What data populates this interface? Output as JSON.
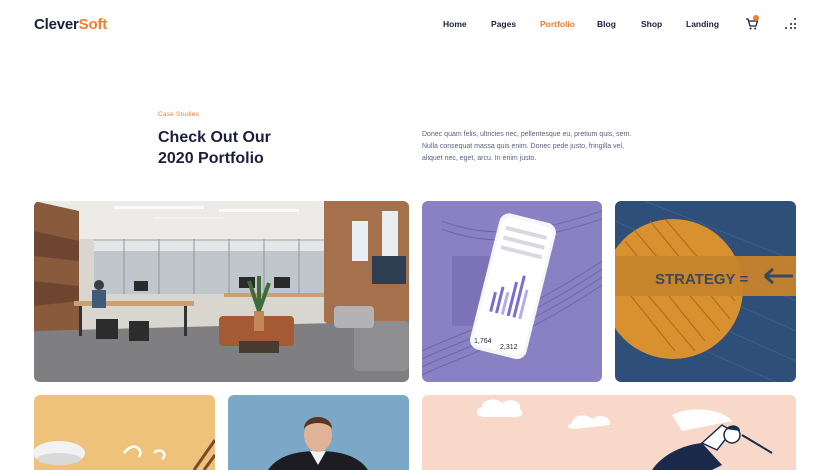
{
  "brand": {
    "part1": "Clever",
    "part2": "Soft"
  },
  "nav": {
    "items": [
      {
        "label": "Home",
        "active": false
      },
      {
        "label": "Pages",
        "active": false
      },
      {
        "label": "Portfolio",
        "active": true
      },
      {
        "label": "Blog",
        "active": false
      },
      {
        "label": "Shop",
        "active": false
      },
      {
        "label": "Landing",
        "active": false
      }
    ],
    "cart_icon": "cart-icon",
    "menu_icon": "grid-dots-icon"
  },
  "intro": {
    "eyebrow": "Case Studies",
    "heading_line1": "Check Out Our",
    "heading_line2": "2020 Portfolio",
    "desc_line1": "Donec quam felis, ultricies nec, pellentesque eu, pretium quis, sem.",
    "desc_line2": "Nulla consequat massa quis enim. Donec pede justo, fringilla vel,",
    "desc_line3": "aliquet nec, eget, arcu. In enim justo."
  },
  "portfolio": {
    "phone_values": {
      "left": "1,764",
      "right": "2,312"
    },
    "strategy_text": "STRATEGY ="
  },
  "colors": {
    "accent": "#f47c2a",
    "text_dark": "#1b1f3b",
    "purple_card": "#8a80c4",
    "blue_card": "#2d4f7a",
    "peach_card": "#f8d8c8",
    "sky_card": "#7aa8c6",
    "yellow_card": "#eec27a"
  }
}
